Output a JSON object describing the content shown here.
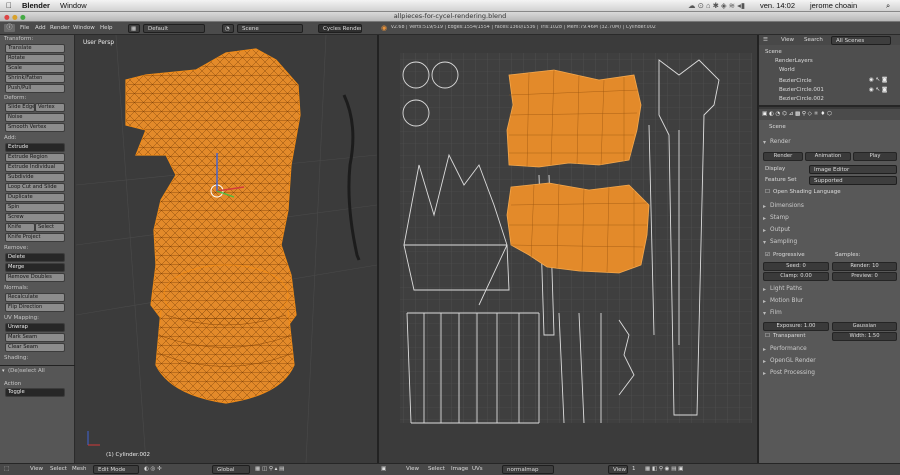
{
  "macmenu": {
    "app": "Blender",
    "window": "Window",
    "clock": "ven. 14:02",
    "user": "jerome choain"
  },
  "window_title": "allpieces-for-cycel-rendering.blend",
  "infobar": {
    "menus": [
      "File",
      "Add",
      "Render",
      "Window",
      "Help"
    ],
    "layout": "Default",
    "scene": "Scene",
    "engine": "Cycles Render",
    "stats": "v2.68 | Verts:519/519 | Edges:1554/1554 | Faces:1360/1536 | Tris:1028 | Mem:79.46M (32.70M) | Cylinder.002"
  },
  "toolshelf": {
    "transform_header": "Transform:",
    "transform": [
      "Translate",
      "Rotate",
      "Scale",
      "Shrink/Fatten",
      "Push/Pull"
    ],
    "deform_header": "Deform:",
    "slide_edge": "Slide Edge",
    "vertex": "Vertex",
    "deform": [
      "Noise",
      "Smooth Vertex"
    ],
    "add_header": "Add:",
    "extrude": "Extrude",
    "add": [
      "Extrude Region",
      "Extrude Individual",
      "Subdivide",
      "Loop Cut and Slide",
      "Duplicate",
      "Spin",
      "Screw"
    ],
    "knife": "Knife",
    "select": "Select",
    "knife_project": "Knife Project",
    "remove_header": "Remove:",
    "delete": "Delete",
    "merge": "Merge",
    "remove_doubles": "Remove Doubles",
    "normals_header": "Normals:",
    "recalculate": "Recalculate",
    "flip_direction": "Flip Direction",
    "uv_header": "UV Mapping:",
    "unwrap": "Unwrap",
    "mark_seam": "Mark Seam",
    "clear_seam": "Clear Seam",
    "shading_header": "Shading:",
    "op_header": "(De)select All",
    "action_label": "Action",
    "action_value": "Toggle"
  },
  "viewport": {
    "label": "User Persp",
    "object": "(1) Cylinder.002"
  },
  "outliner": {
    "view": "View",
    "search": "Search",
    "filter": "All Scenes",
    "items": [
      "Scene",
      "RenderLayers",
      "World",
      "BezierCircle",
      "BezierCircle.001",
      "BezierCircle.002"
    ]
  },
  "properties": {
    "context": "Scene",
    "render_panel": "Render",
    "render_btn": "Render",
    "animation_btn": "Animation",
    "play_btn": "Play",
    "display_label": "Display",
    "display_value": "Image Editor",
    "featureset_label": "Feature Set",
    "featureset_value": "Supported",
    "osl": "Open Shading Language",
    "dimensions": "Dimensions",
    "stamp": "Stamp",
    "output": "Output",
    "sampling": "Sampling",
    "progressive": "Progressive",
    "samples_label": "Samples:",
    "seed": "Seed: 0",
    "clamp": "Clamp: 0.00",
    "render_samples": "Render: 10",
    "preview_samples": "Preview: 0",
    "light_paths": "Light Paths",
    "motion_blur": "Motion Blur",
    "film": "Film",
    "exposure": "Exposure: 1.00",
    "filter_type": "Gaussian",
    "transparent": "Transparent",
    "width": "Width: 1.50",
    "performance": "Performance",
    "opengl_render": "OpenGL Render",
    "post_processing": "Post Processing"
  },
  "bottombar": {
    "v_view": "View",
    "v_select": "Select",
    "v_mesh": "Mesh",
    "mode": "Edit Mode",
    "pivot": "Global",
    "uv_view": "View",
    "uv_select": "Select",
    "uv_image": "Image",
    "uv_uvs": "UVs",
    "uv_map": "normalmap",
    "uv_slot": "View",
    "uv_slot_num": "1"
  },
  "colors": {
    "mesh": "#f08c1a",
    "mesh_face": "#e38a2a",
    "wire": "#1a1a1a",
    "select": "#f5a84c"
  }
}
